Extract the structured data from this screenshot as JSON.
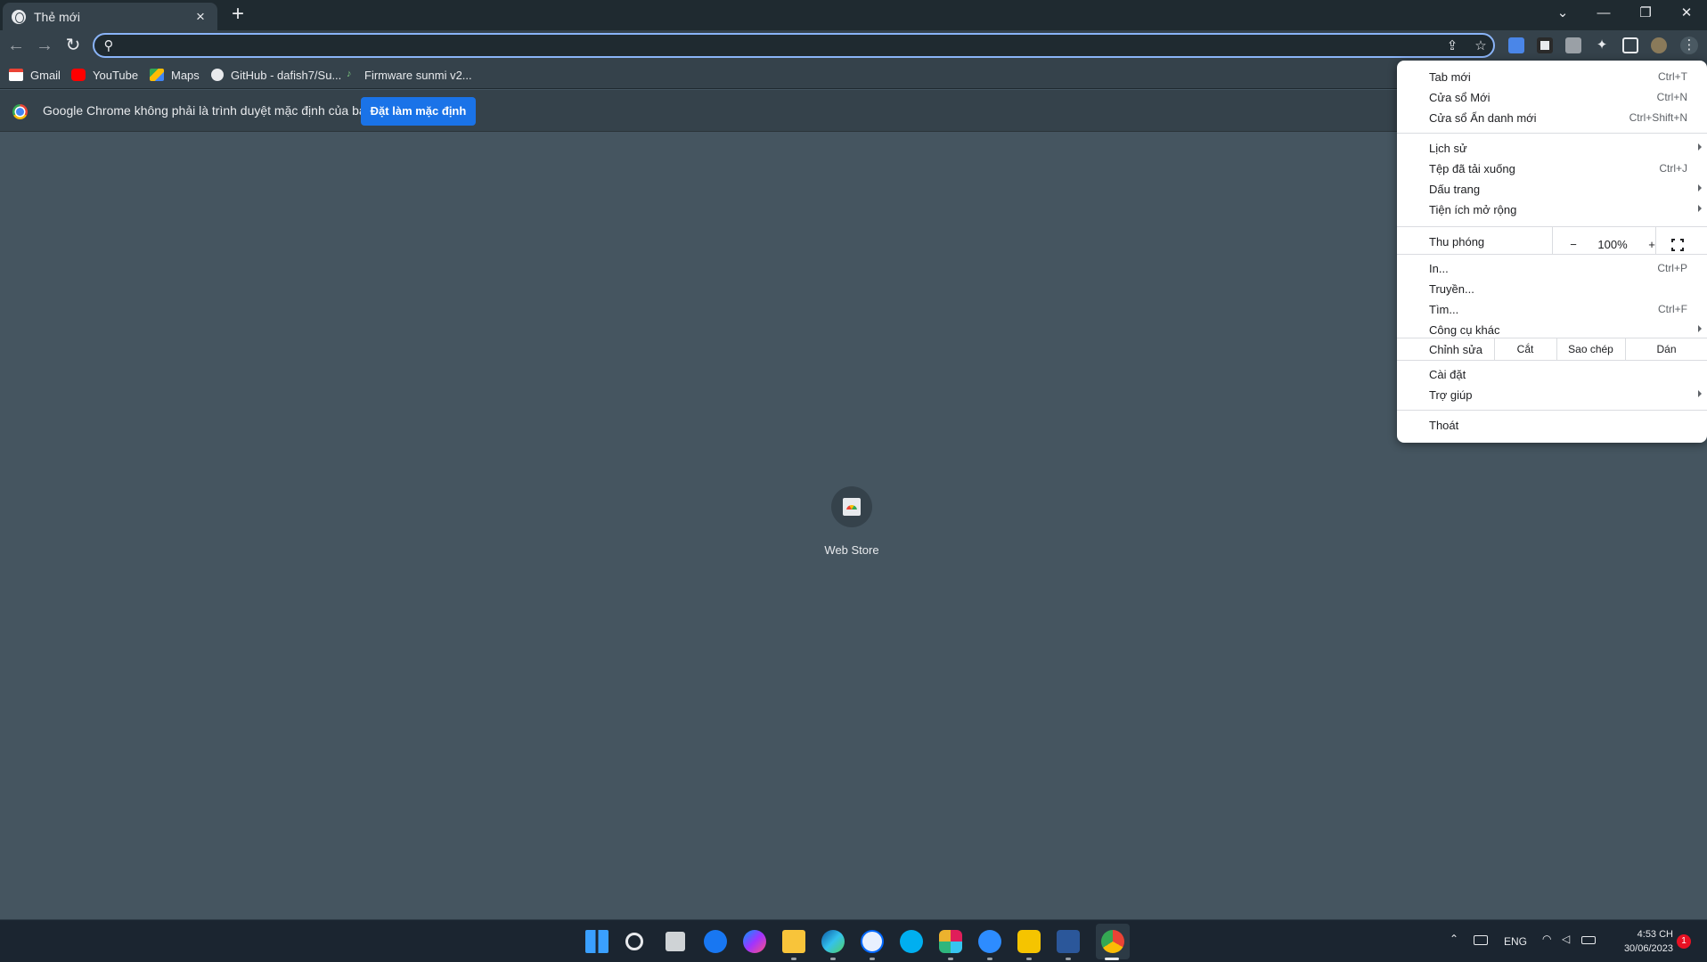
{
  "tab": {
    "title": "Thẻ mới"
  },
  "bookmarks": [
    {
      "label": "Gmail",
      "icon": "gmail-icon"
    },
    {
      "label": "YouTube",
      "icon": "youtube-icon"
    },
    {
      "label": "Maps",
      "icon": "maps-icon"
    },
    {
      "label": "GitHub - dafish7/Su...",
      "icon": "github-icon"
    },
    {
      "label": "Firmware sunmi v2...",
      "icon": "bookmark-icon"
    }
  ],
  "infobar": {
    "message": "Google Chrome không phải là trình duyệt mặc định của bạn",
    "button": "Đặt làm mặc định"
  },
  "shortcut": {
    "label": "Web Store"
  },
  "menu": {
    "new_tab": {
      "label": "Tab mới",
      "shortcut": "Ctrl+T"
    },
    "new_window": {
      "label": "Cửa sổ Mới",
      "shortcut": "Ctrl+N"
    },
    "incognito": {
      "label": "Cửa sổ Ẩn danh mới",
      "shortcut": "Ctrl+Shift+N"
    },
    "history": {
      "label": "Lịch sử"
    },
    "downloads": {
      "label": "Tệp đã tải xuống",
      "shortcut": "Ctrl+J"
    },
    "bookmarks": {
      "label": "Dấu trang"
    },
    "extensions": {
      "label": "Tiện ích mở rộng"
    },
    "zoom": {
      "label": "Thu phóng",
      "minus": "−",
      "value": "100%",
      "plus": "+"
    },
    "print": {
      "label": "In...",
      "shortcut": "Ctrl+P"
    },
    "cast": {
      "label": "Truyền..."
    },
    "find": {
      "label": "Tìm...",
      "shortcut": "Ctrl+F"
    },
    "more_tools": {
      "label": "Công cụ khác"
    },
    "edit": {
      "label": "Chỉnh sửa",
      "cut": "Cắt",
      "copy": "Sao chép",
      "paste": "Dán"
    },
    "settings": {
      "label": "Cài đặt"
    },
    "help": {
      "label": "Trợ giúp"
    },
    "exit": {
      "label": "Thoát"
    }
  },
  "taskbar": {
    "language": "ENG",
    "time": "4:53 CH",
    "date": "30/06/2023",
    "notification_count": "1"
  },
  "colors": {
    "page_background": "#455560",
    "accent": "#1a73e8",
    "toolbar": "#35424b"
  }
}
